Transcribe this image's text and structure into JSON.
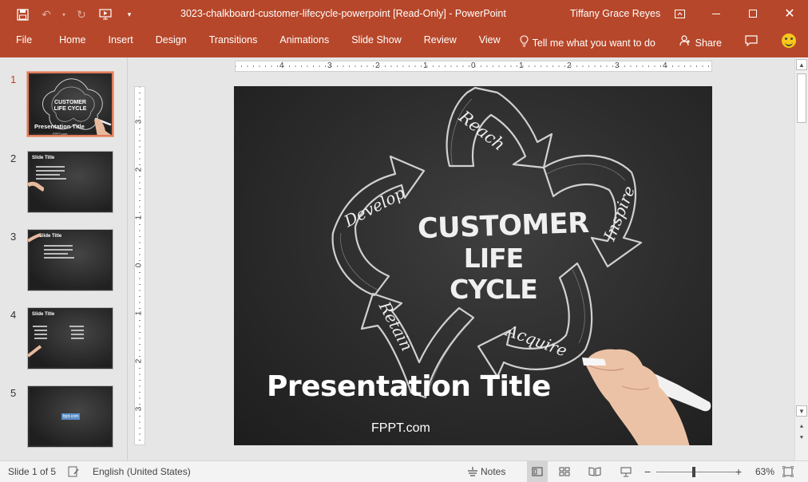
{
  "titlebar": {
    "doc_title": "3023-chalkboard-customer-lifecycle-powerpoint [Read-Only]  -  PowerPoint",
    "user": "Tiffany Grace Reyes"
  },
  "ribbon": {
    "tabs": [
      "File",
      "Home",
      "Insert",
      "Design",
      "Transitions",
      "Animations",
      "Slide Show",
      "Review",
      "View"
    ],
    "tell_me": "Tell me what you want to do",
    "share": "Share"
  },
  "rulers": {
    "h_ticks": [
      "4",
      "3",
      "2",
      "1",
      "0",
      "1",
      "2",
      "3",
      "4"
    ],
    "v_ticks": [
      "3",
      "2",
      "1",
      "0",
      "1",
      "2",
      "3"
    ]
  },
  "thumbnails": [
    {
      "num": "1",
      "title": "Presentation Title",
      "sub": "FPPT.com",
      "kind": "title",
      "active": true
    },
    {
      "num": "2",
      "title": "Slide Title",
      "kind": "bullets",
      "active": false
    },
    {
      "num": "3",
      "title": "Slide Title",
      "kind": "bullets",
      "active": false
    },
    {
      "num": "4",
      "title": "Slide Title",
      "kind": "columns",
      "active": false
    },
    {
      "num": "5",
      "sub": "fppt.com",
      "kind": "end",
      "active": false
    }
  ],
  "slide": {
    "cycle_center_lines": [
      "CUSTOMER",
      "LIFE CYCLE"
    ],
    "stage_labels": {
      "reach": "Reach",
      "inspire": "Inspire",
      "acquire": "Acquire",
      "retain": "Retain",
      "develop": "Develop"
    },
    "title": "Presentation Title",
    "subtitle": "FPPT.com"
  },
  "status": {
    "slide_info": "Slide 1 of 5",
    "language": "English (United States)",
    "notes": "Notes",
    "zoom": "63%",
    "zoom_fraction": 0.47
  },
  "colors": {
    "accent": "#b7472a",
    "chalk": "#e8e8e8",
    "board": "#2e2e2e"
  }
}
